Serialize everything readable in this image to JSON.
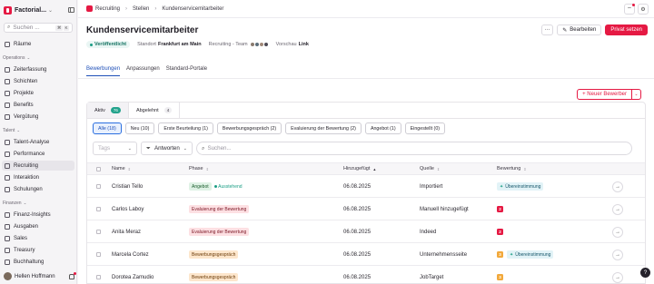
{
  "app": {
    "name": "Factorial...",
    "search_placeholder": "Suchen ...",
    "shortcut_keys": [
      "⌘",
      "K"
    ],
    "accent": "#e51943"
  },
  "sidebar": {
    "top_item": {
      "label": "Räume"
    },
    "sections": [
      {
        "label": "Operations",
        "items": [
          "Zeiterfassung",
          "Schichten",
          "Projekte",
          "Benefits",
          "Vergütung"
        ]
      },
      {
        "label": "Talent",
        "items": [
          "Talent-Analyse",
          "Performance",
          "Recruiting",
          "Interaktion",
          "Schulungen"
        ]
      },
      {
        "label": "Finanzen",
        "items": [
          "Finanz-Insights",
          "Ausgaben",
          "Sales",
          "Treasury",
          "Buchhaltung"
        ]
      }
    ],
    "user": "Hellen Hoffmann"
  },
  "breadcrumb": [
    "Recruiting",
    "Stellen",
    "Kundenservicemitarbeiter"
  ],
  "header": {
    "title": "Kundenservicemitarbeiter",
    "edit_label": "Bearbeiten",
    "private_label": "Privat setzen",
    "more_label": "···"
  },
  "meta": {
    "status": "Veröffentlicht",
    "location_label": "Standort",
    "location_value": "Frankfurt am Main",
    "team_label": "Recruiting - Team",
    "preview_label": "Vorschau",
    "preview_value": "Link"
  },
  "tabs": [
    "Bewerbungen",
    "Anpassungen",
    "Standard-Portale"
  ],
  "new_applicant_label": "+ Neuer Bewerber",
  "subtabs": [
    {
      "label": "Aktiv",
      "count": "76"
    },
    {
      "label": "Abgelehnt",
      "count": "4"
    }
  ],
  "filter_chips": [
    "Alle (18)",
    "Neu (10)",
    "Erste Beurteilung (1)",
    "Bewerbungsgespräch (2)",
    "Evaluierung der Bewertung (2)",
    "Angebot (1)",
    "Eingestellt (0)"
  ],
  "filters": {
    "tags_placeholder": "Tags",
    "answers_label": "Antworten",
    "search_placeholder": "Suchen..."
  },
  "table": {
    "columns": [
      "Name",
      "Phase",
      "Hinzugefügt",
      "Quelle",
      "Bewertung"
    ],
    "rows": [
      {
        "name": "Cristian Tello",
        "phase": "Angebot",
        "phase_color": "green",
        "phase_sub": "Ausstehend",
        "date": "06.08.2025",
        "source": "Importiert",
        "score": "",
        "match": "Übereinstimmung"
      },
      {
        "name": "Carlos Laboy",
        "phase": "Evaluierung der Bewertung",
        "phase_color": "red",
        "phase_sub": "",
        "date": "06.08.2025",
        "source": "Manuell hinzugefügt",
        "score": "2",
        "score_color": "red",
        "match": ""
      },
      {
        "name": "Anita Meraz",
        "phase": "Evaluierung der Bewertung",
        "phase_color": "red",
        "phase_sub": "",
        "date": "06.08.2025",
        "source": "Indeed",
        "score": "2",
        "score_color": "red",
        "match": ""
      },
      {
        "name": "Marcela Cortez",
        "phase": "Bewerbungsgespräch",
        "phase_color": "orange",
        "phase_sub": "",
        "date": "06.08.2025",
        "source": "Unternehmensseite",
        "score": "3",
        "score_color": "orange",
        "match": "Übereinstimmung"
      },
      {
        "name": "Dorotea Zamudio",
        "phase": "Bewerbungsgespräch",
        "phase_color": "orange",
        "phase_sub": "",
        "date": "06.08.2025",
        "source": "JobTarget",
        "score": "3",
        "score_color": "orange",
        "match": ""
      }
    ]
  }
}
